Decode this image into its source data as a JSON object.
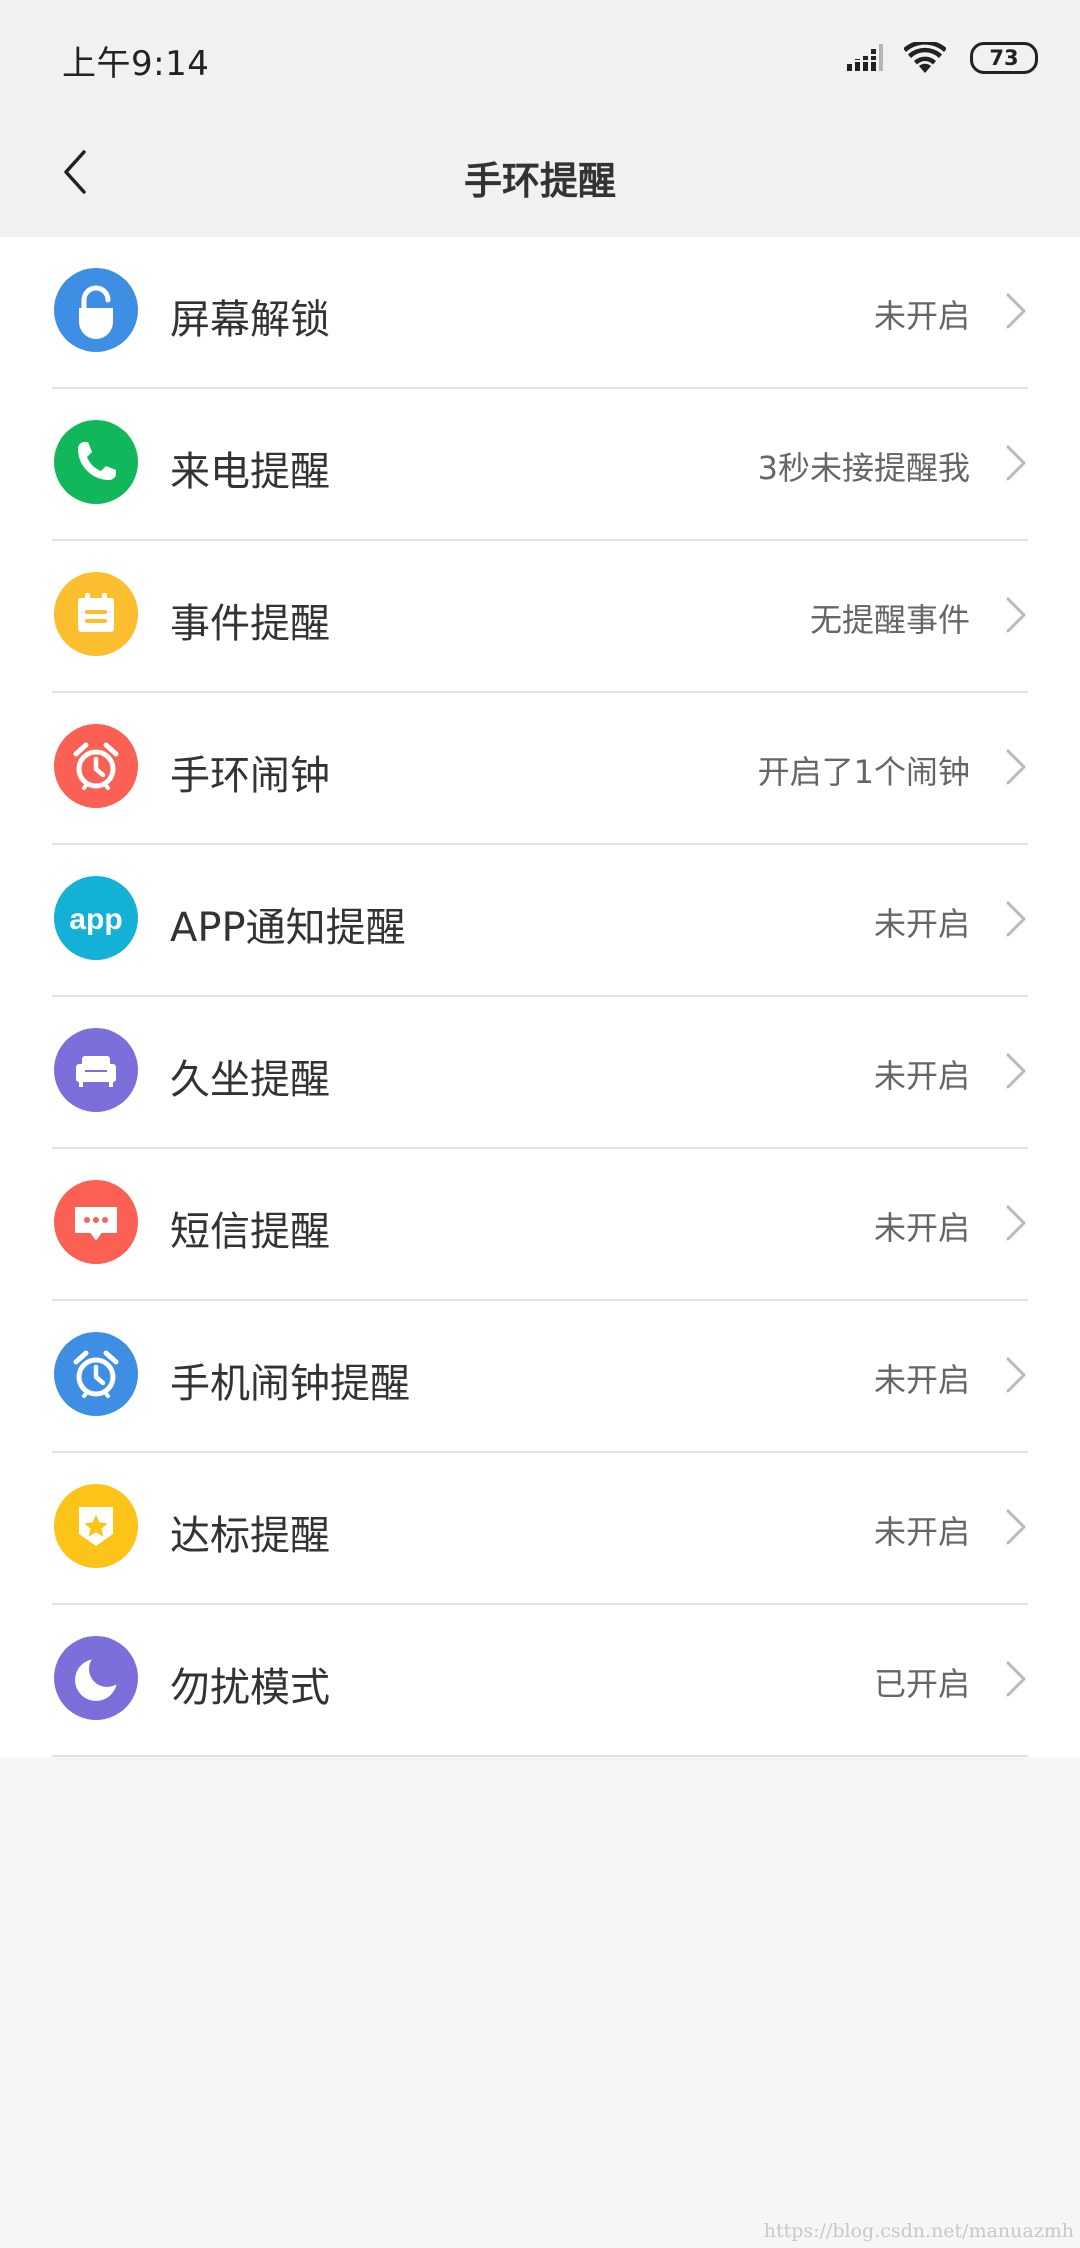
{
  "status_bar": {
    "time": "上午9:14",
    "battery": "73"
  },
  "nav": {
    "title": "手环提醒"
  },
  "items": [
    {
      "label": "屏幕解锁",
      "status": "未开启",
      "icon": "unlock-icon",
      "color": "#3e8ee3"
    },
    {
      "label": "来电提醒",
      "status": "3秒未接提醒我",
      "icon": "phone-icon",
      "color": "#11b85b"
    },
    {
      "label": "事件提醒",
      "status": "无提醒事件",
      "icon": "calendar-icon",
      "color": "#fbbe2e"
    },
    {
      "label": "手环闹钟",
      "status": "开启了1个闹钟",
      "icon": "alarm-icon",
      "color": "#fb6054"
    },
    {
      "label": "APP通知提醒",
      "status": "未开启",
      "icon": "app-icon",
      "color": "#13b1d6"
    },
    {
      "label": "久坐提醒",
      "status": "未开启",
      "icon": "sofa-icon",
      "color": "#7c6fd9"
    },
    {
      "label": "短信提醒",
      "status": "未开启",
      "icon": "message-icon",
      "color": "#fb6054"
    },
    {
      "label": "手机闹钟提醒",
      "status": "未开启",
      "icon": "alarm-icon",
      "color": "#3e8ee3"
    },
    {
      "label": "达标提醒",
      "status": "未开启",
      "icon": "badge-star-icon",
      "color": "#fcc419"
    },
    {
      "label": "勿扰模式",
      "status": "已开启",
      "icon": "moon-icon",
      "color": "#7c6fd9"
    }
  ],
  "watermark": "https://blog.csdn.net/manuazmh"
}
